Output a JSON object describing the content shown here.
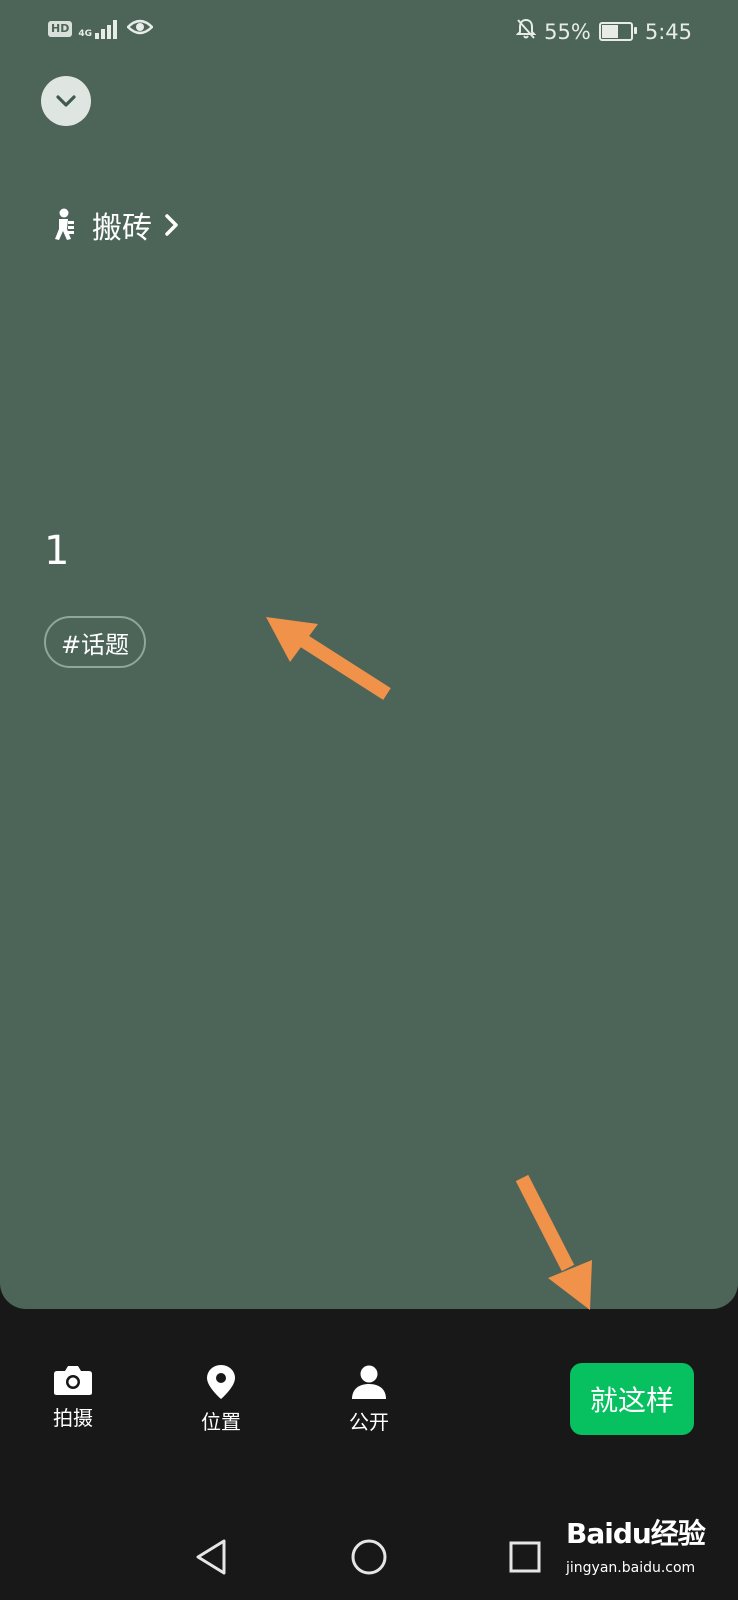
{
  "status_bar": {
    "hd": "HD",
    "network_type": "4G",
    "battery_text": "55%",
    "battery_level": 0.55,
    "time": "5:45"
  },
  "category": {
    "label": "搬砖"
  },
  "post": {
    "text": "1"
  },
  "topic_chip": {
    "label": "#话题"
  },
  "bottom_bar": {
    "camera_label": "拍摄",
    "location_label": "位置",
    "visibility_label": "公开",
    "done_label": "就这样"
  },
  "watermark": {
    "title": "Baidu经验",
    "url": "jingyan.baidu.com"
  },
  "colors": {
    "background": "#4c6558",
    "primary": "#07c160",
    "annotation_arrow": "#f0924a"
  }
}
